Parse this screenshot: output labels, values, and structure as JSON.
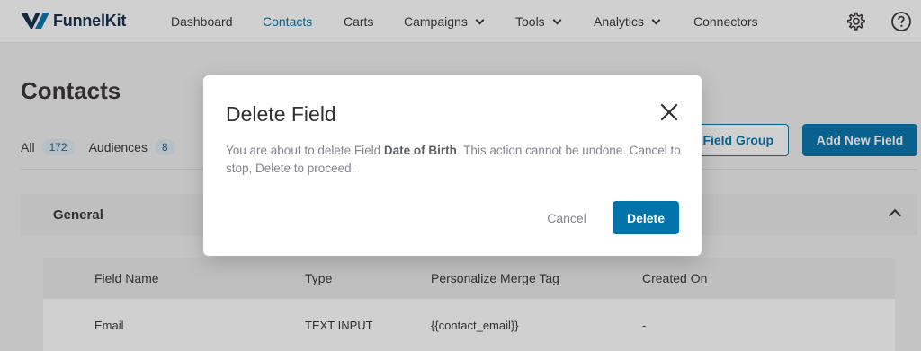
{
  "brand": {
    "name": "FunnelKit"
  },
  "nav": {
    "items": [
      {
        "label": "Dashboard"
      },
      {
        "label": "Contacts"
      },
      {
        "label": "Carts"
      },
      {
        "label": "Campaigns"
      },
      {
        "label": "Tools"
      },
      {
        "label": "Analytics"
      },
      {
        "label": "Connectors"
      }
    ],
    "active": "Contacts",
    "icons": [
      "gear-icon",
      "help-icon"
    ]
  },
  "page": {
    "title": "Contacts",
    "tabs": [
      {
        "label": "All",
        "count": "172"
      },
      {
        "label": "Audiences",
        "count": "8"
      }
    ],
    "buttons": {
      "field_group": "Field Group",
      "add_new_field": "Add New Field"
    },
    "group": {
      "title": "General"
    },
    "table": {
      "columns": [
        "Field Name",
        "Type",
        "Personalize Merge Tag",
        "Created On"
      ],
      "rows": [
        {
          "name": "Email",
          "type": "TEXT INPUT",
          "tag": "{{contact_email}}",
          "created": "-"
        }
      ]
    }
  },
  "modal": {
    "title": "Delete Field",
    "text_before": "You are about to delete Field ",
    "field_name": "Date of Birth",
    "text_after": ". This action cannot be undone. Cancel to stop, Delete to proceed.",
    "cancel_label": "Cancel",
    "delete_label": "Delete"
  },
  "colors": {
    "accent": "#0073aa",
    "brand_dark": "#12294a"
  }
}
